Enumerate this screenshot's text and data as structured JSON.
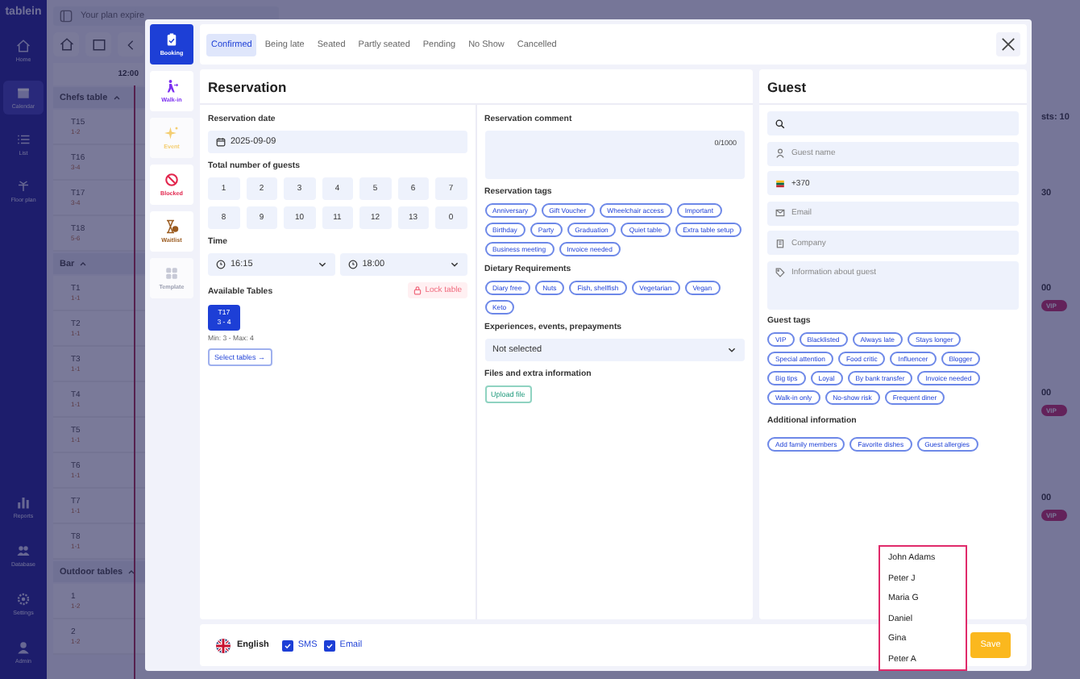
{
  "sidebar": {
    "logo": "tablein",
    "items": [
      {
        "label": "Home",
        "selected": false
      },
      {
        "label": "Calendar",
        "selected": true
      },
      {
        "label": "List",
        "selected": false
      },
      {
        "label": "Floor plan",
        "selected": false
      }
    ],
    "bottom_items": [
      {
        "label": "Reports",
        "selected": false
      },
      {
        "label": "Database",
        "selected": false
      },
      {
        "label": "Settings",
        "selected": false
      },
      {
        "label": "Admin",
        "selected": false
      }
    ]
  },
  "banner": {
    "text": "Your plan expire"
  },
  "schedule": {
    "time": "12:00",
    "groups": [
      {
        "name": "Chefs table",
        "expanded": true,
        "tables": [
          {
            "name": "T15",
            "capacity": "1-2"
          },
          {
            "name": "T16",
            "capacity": "3-4"
          },
          {
            "name": "T17",
            "capacity": "3-4"
          },
          {
            "name": "T18",
            "capacity": "5-6"
          }
        ]
      },
      {
        "name": "Bar",
        "expanded": true,
        "tables": [
          {
            "name": "T1",
            "capacity": "1-1"
          },
          {
            "name": "T2",
            "capacity": "1-1"
          },
          {
            "name": "T3",
            "capacity": "1-1"
          },
          {
            "name": "T4",
            "capacity": "1-1"
          },
          {
            "name": "T5",
            "capacity": "1-1"
          },
          {
            "name": "T6",
            "capacity": "1-1"
          },
          {
            "name": "T7",
            "capacity": "1-1"
          },
          {
            "name": "T8",
            "capacity": "1-1"
          }
        ]
      },
      {
        "name": "Outdoor tables",
        "expanded": true,
        "tables": [
          {
            "name": "1",
            "capacity": "1-2"
          },
          {
            "name": "2",
            "capacity": "1-2"
          }
        ]
      }
    ]
  },
  "right_strip": {
    "guests": "sts: 10",
    "bookings": [
      {
        "time": "30"
      },
      {
        "time": "00",
        "badge": "VIP"
      },
      {
        "time": "00",
        "badge": "VIP"
      },
      {
        "time": "00",
        "badge": "VIP"
      }
    ]
  },
  "modal": {
    "types": [
      {
        "label": "Booking",
        "kind": "booking",
        "selected": true,
        "disabled": false
      },
      {
        "label": "Walk-in",
        "kind": "walkin",
        "selected": false,
        "disabled": false
      },
      {
        "label": "Event",
        "kind": "event",
        "selected": false,
        "disabled": true
      },
      {
        "label": "Blocked",
        "kind": "blocked",
        "selected": false,
        "disabled": false
      },
      {
        "label": "Waitlist",
        "kind": "waitlist",
        "selected": false,
        "disabled": false
      },
      {
        "label": "Template",
        "kind": "template",
        "selected": false,
        "disabled": true
      }
    ],
    "statuses": [
      {
        "label": "Confirmed",
        "selected": true
      },
      {
        "label": "Being late",
        "selected": false
      },
      {
        "label": "Seated",
        "selected": false
      },
      {
        "label": "Partly seated",
        "selected": false
      },
      {
        "label": "Pending",
        "selected": false
      },
      {
        "label": "No Show",
        "selected": false
      },
      {
        "label": "Cancelled",
        "selected": false
      }
    ],
    "reservation": {
      "title": "Reservation",
      "date_label": "Reservation date",
      "date": "2025-09-09",
      "guests_label": "Total number of guests",
      "guest_counts": [
        {
          "label": "1",
          "selected": false
        },
        {
          "label": "2",
          "selected": false
        },
        {
          "label": "3",
          "selected": false
        },
        {
          "label": "4",
          "selected": false
        },
        {
          "label": "5",
          "selected": false
        },
        {
          "label": "6",
          "selected": false
        },
        {
          "label": "7",
          "selected": false
        },
        {
          "label": "8",
          "selected": false
        },
        {
          "label": "9",
          "selected": false
        },
        {
          "label": "10",
          "selected": false
        },
        {
          "label": "11",
          "selected": false
        },
        {
          "label": "12",
          "selected": false
        },
        {
          "label": "13",
          "selected": false
        },
        {
          "label": "0",
          "selected": false
        }
      ],
      "time_label": "Time",
      "start": "16:15",
      "end": "18:00",
      "tables_label": "Available Tables",
      "lock_label": "Lock table",
      "tables": [
        {
          "name": "T17",
          "capacity": "3 - 4",
          "selected": true
        }
      ],
      "min_max": "Min: 3 - Max: 4",
      "select_tables": "Select tables →",
      "comment_label": "Reservation comment",
      "comment_counter": "0/1000",
      "tag_groups": [
        {
          "label": "Reservation tags",
          "tags": [
            "Anniversary",
            "Gift Voucher",
            "Wheelchair access",
            "Important",
            "Birthday",
            "Party",
            "Graduation",
            "Quiet table",
            "Extra table setup",
            "Business meeting",
            "Invoice needed"
          ]
        },
        {
          "label": "Dietary Requirements",
          "tags": [
            "Diary free",
            "Nuts",
            "Fish, shellfish",
            "Vegetarian",
            "Vegan",
            "Keto"
          ]
        }
      ],
      "experiences_label": "Experiences, events, prepayments",
      "experiences_value": "Not selected",
      "files_label": "Files and extra information",
      "upload": "Upload file"
    },
    "guest": {
      "title": "Guest",
      "fields": [
        {
          "kind": "search"
        },
        {
          "kind": "person",
          "placeholder": "Guest name"
        },
        {
          "kind": "phone",
          "value": "+370"
        },
        {
          "kind": "email",
          "placeholder": "Email"
        },
        {
          "kind": "company",
          "placeholder": "Company"
        },
        {
          "kind": "info",
          "placeholder": "Information about guest"
        }
      ],
      "tags_label": "Guest tags",
      "tags": [
        "VIP",
        "Blacklisted",
        "Always late",
        "Stays longer",
        "Special attention",
        "Food critic",
        "Influencer",
        "Blogger",
        "Big tips",
        "Loyal",
        "By bank transfer",
        "Invoice needed",
        "Walk-in only",
        "No-show risk",
        "Frequent diner"
      ],
      "additional_label": "Additional information",
      "additional": [
        "Add family members",
        "Favorite dishes",
        "Guest allergies"
      ]
    }
  },
  "footer": {
    "language": "English",
    "sms": {
      "label": "SMS",
      "checked": true
    },
    "email": {
      "label": "Email",
      "checked": true
    },
    "save": "Save"
  },
  "suggestions": [
    "John Adams",
    "Peter J",
    "Maria G",
    "Daniel",
    "Gina",
    "Peter A"
  ]
}
